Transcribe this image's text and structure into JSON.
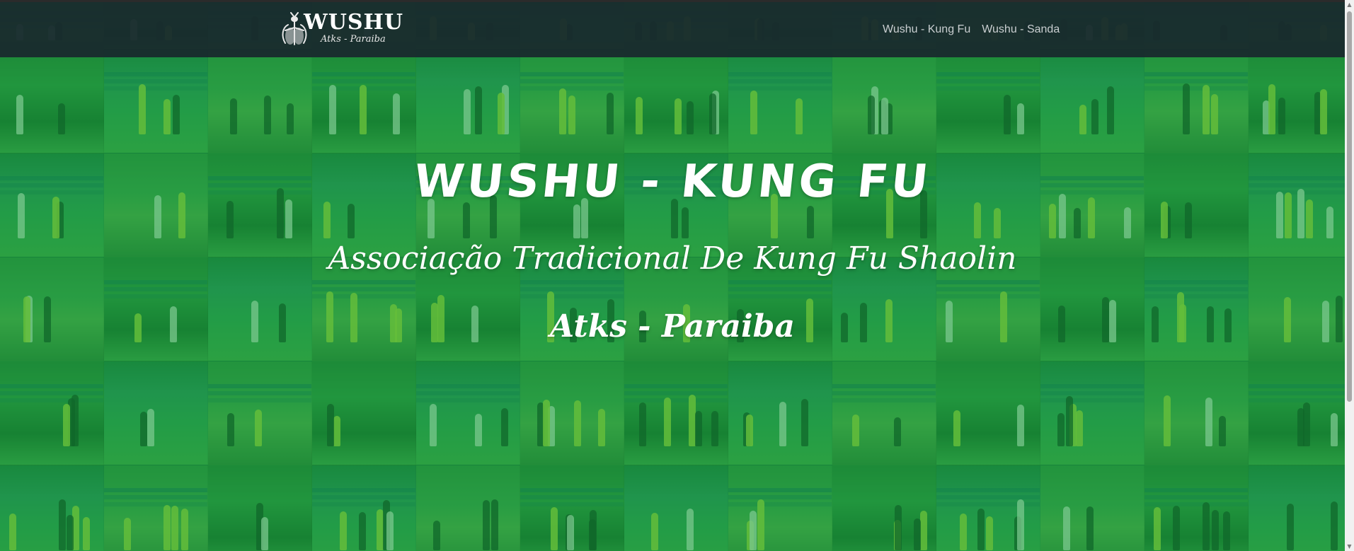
{
  "navbar": {
    "brand": {
      "title": "WUSHU",
      "subtitle": "Atks - Paraiba",
      "icon": "mantis-icon"
    },
    "links": [
      {
        "label": "Wushu - Kung Fu"
      },
      {
        "label": "Wushu - Sanda"
      }
    ]
  },
  "hero": {
    "title": "WUSHU - KUNG FU",
    "subtitle_regular": "Associação Tradicional De Kung Fu Shaolin ",
    "subtitle_bold": "Atks - Paraiba"
  },
  "colors": {
    "navbar_bg": "#19282d",
    "overlay_green": "#14a03c",
    "text_white": "#ffffff",
    "nav_link": "#c9ced0"
  }
}
